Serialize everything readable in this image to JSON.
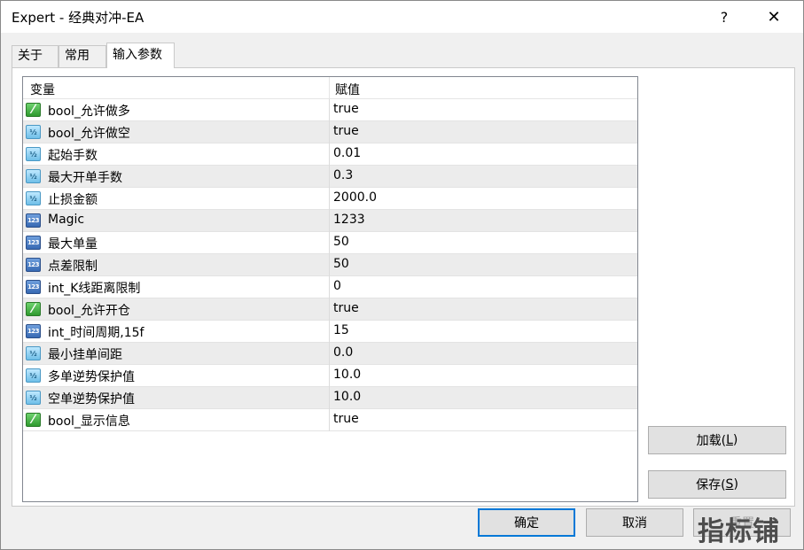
{
  "window": {
    "title": "Expert - 经典对冲-EA",
    "help": "?",
    "close": "✕"
  },
  "tabs": [
    {
      "label": "关于"
    },
    {
      "label": "常用"
    },
    {
      "label": "输入参数"
    }
  ],
  "grid": {
    "headers": {
      "variable": "变量",
      "value": "赋值"
    },
    "rows": [
      {
        "type": "bool",
        "name": "bool_允许做多",
        "value": "true"
      },
      {
        "type": "double",
        "name": "bool_允许做空",
        "value": "true"
      },
      {
        "type": "double",
        "name": "起始手数",
        "value": "0.01"
      },
      {
        "type": "double",
        "name": "最大开单手数",
        "value": "0.3"
      },
      {
        "type": "double",
        "name": "止损金额",
        "value": "2000.0"
      },
      {
        "type": "int",
        "name": "Magic",
        "value": "1233"
      },
      {
        "type": "int",
        "name": "最大单量",
        "value": "50"
      },
      {
        "type": "int",
        "name": "点差限制",
        "value": "50"
      },
      {
        "type": "int",
        "name": "int_K线距离限制",
        "value": "0"
      },
      {
        "type": "bool",
        "name": "bool_允许开仓",
        "value": "true"
      },
      {
        "type": "int",
        "name": "int_时间周期,15f",
        "value": "15"
      },
      {
        "type": "double",
        "name": "最小挂单间距",
        "value": "0.0"
      },
      {
        "type": "double",
        "name": "多单逆势保护值",
        "value": "10.0"
      },
      {
        "type": "double",
        "name": "空单逆势保护值",
        "value": "10.0"
      },
      {
        "type": "bool",
        "name": "bool_显示信息",
        "value": "true"
      }
    ]
  },
  "buttons": {
    "load": {
      "label": "加载(",
      "key": "L",
      "close": ")"
    },
    "save": {
      "label": "保存(",
      "key": "S",
      "close": ")"
    },
    "ok": "确定",
    "cancel": "取消",
    "reset": "重置"
  },
  "watermark": "指标铺",
  "icons": {
    "bool": "bool-toggle-icon",
    "double": "double-value-icon",
    "int": "integer-value-icon"
  }
}
